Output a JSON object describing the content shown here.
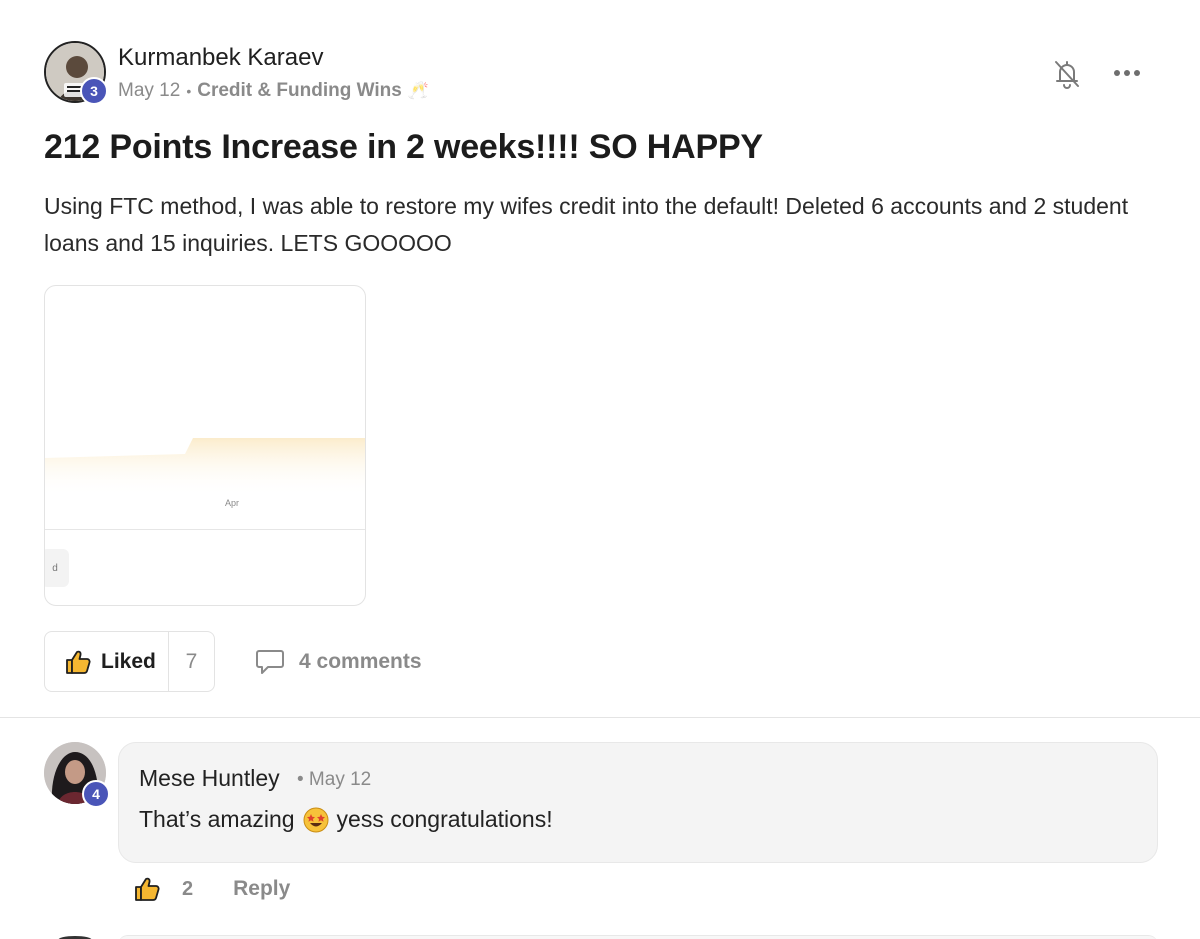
{
  "post": {
    "author": {
      "name": "Kurmanbek Karaev",
      "level": "3"
    },
    "date": "May 12",
    "separator": "•",
    "category": "Credit & Funding Wins",
    "category_emoji": "🥂",
    "title": "212 Points Increase in 2 weeks!!!! SO HAPPY",
    "body": "Using FTC method, I was able to restore my wifes credit into the default! Deleted 6 accounts and 2 student loans and 15 inquiries. LETS GOOOOO",
    "preview": {
      "month_label": "Apr",
      "pill_text": "d"
    },
    "reactions": {
      "liked_label": "Liked",
      "like_count": "7",
      "comments_label": "4 comments"
    }
  },
  "comments": [
    {
      "author": "Mese Huntley",
      "level": "4",
      "meta": "• May 12",
      "text_before_emoji": "That’s amazing",
      "text_after_emoji": "yess congratulations!",
      "like_count": "2",
      "reply_label": "Reply"
    }
  ],
  "icons": {
    "bell": "bell-off-icon",
    "more": "more-horizontal-icon",
    "thumb": "thumbs-up-icon",
    "comment": "comment-bubble-icon",
    "emoji": "star-struck-emoji"
  },
  "colors": {
    "badge": "#4a55b8",
    "muted": "#8a8a8a",
    "chart_fill": "#fbeccc"
  }
}
